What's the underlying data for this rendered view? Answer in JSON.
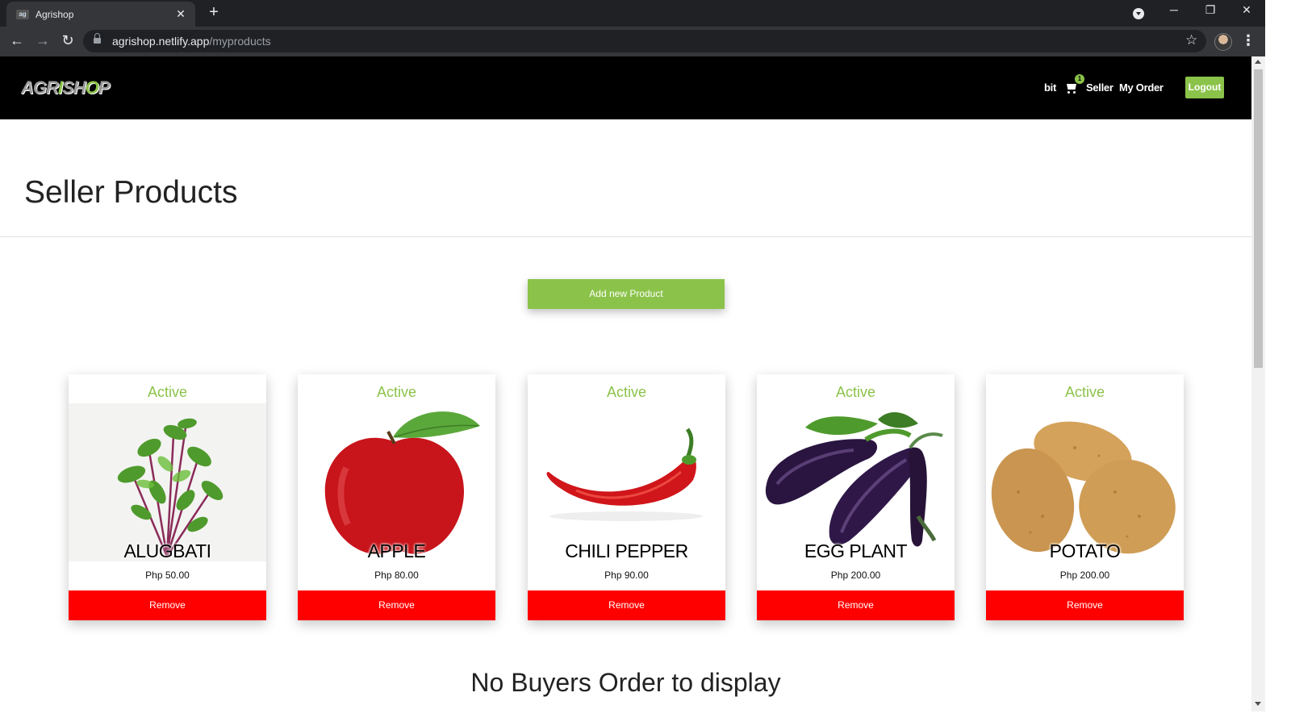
{
  "browser": {
    "tab_title": "Agrishop",
    "tab_favicon": "agrishop-favicon",
    "url_host": "agrishop.netlify.app",
    "url_path": "/myproducts"
  },
  "site": {
    "logo": "AGRISHOP",
    "nav": {
      "user": "bit",
      "cart_count": "1",
      "seller": "Seller",
      "my_order": "My Order",
      "logout": "Logout"
    }
  },
  "page": {
    "title": "Seller Products",
    "add_button": "Add new Product",
    "products": [
      {
        "status": "Active",
        "name": "ALUGBATI",
        "price": "Php 50.00",
        "remove": "Remove",
        "image": "alugbati-leaves"
      },
      {
        "status": "Active",
        "name": "APPLE",
        "price": "Php 80.00",
        "remove": "Remove",
        "image": "red-apple"
      },
      {
        "status": "Active",
        "name": "CHILI PEPPER",
        "price": "Php 90.00",
        "remove": "Remove",
        "image": "red-chili-pepper"
      },
      {
        "status": "Active",
        "name": "EGG PLANT",
        "price": "Php 200.00",
        "remove": "Remove",
        "image": "eggplants"
      },
      {
        "status": "Active",
        "name": "POTATO",
        "price": "Php 200.00",
        "remove": "Remove",
        "image": "potatoes"
      }
    ],
    "empty_message": "No Buyers Order to display"
  },
  "colors": {
    "accent_green": "#8bc34a",
    "remove_red": "#ff0000",
    "nav_black": "#000000"
  }
}
